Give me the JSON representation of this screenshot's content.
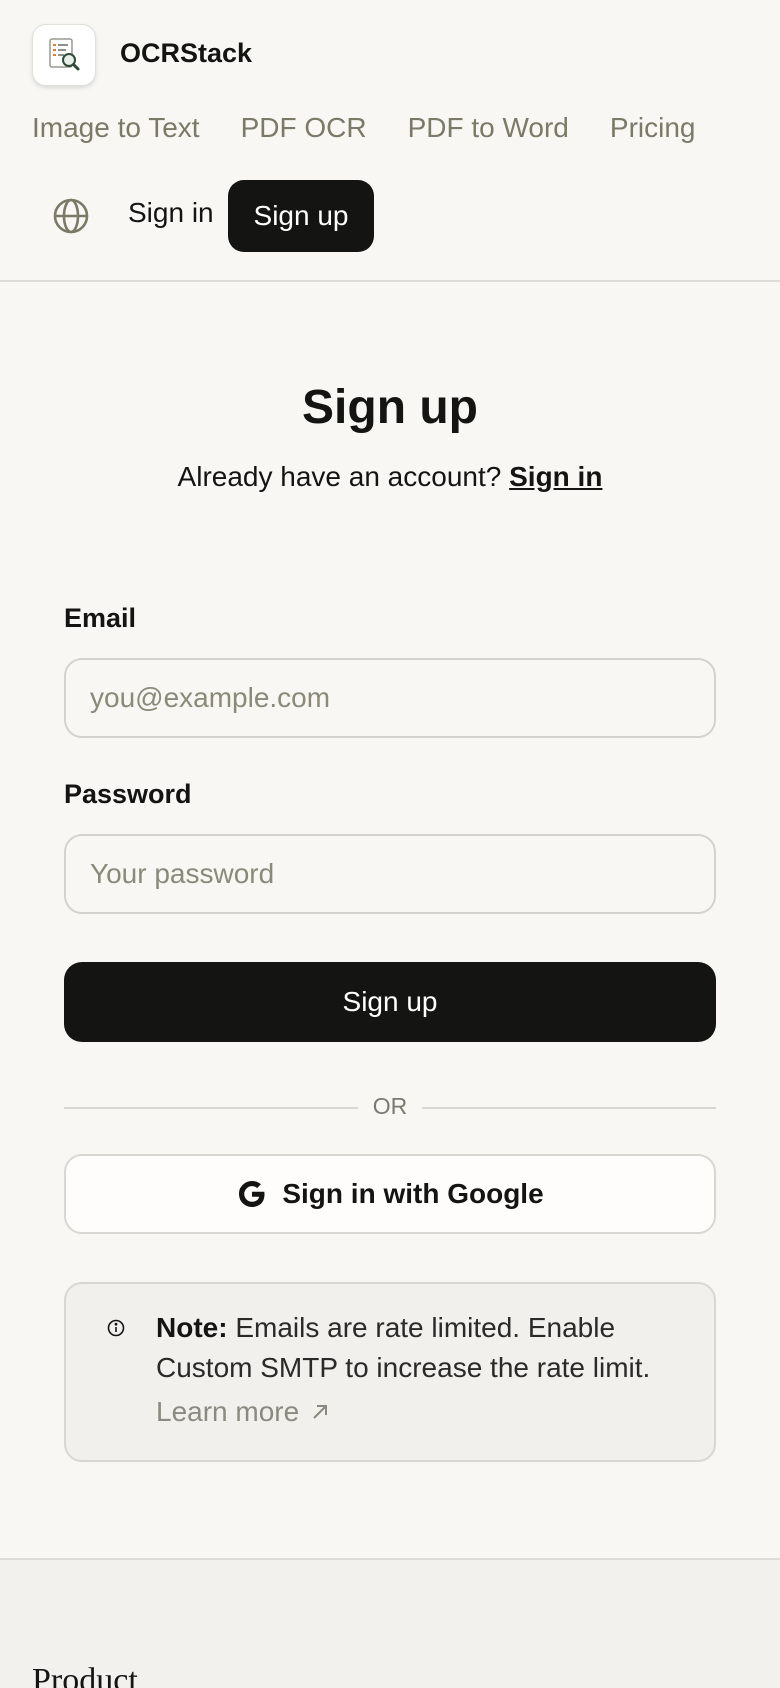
{
  "header": {
    "brand": "OCRStack",
    "logo_icon": "document-search-icon",
    "nav": [
      {
        "label": "Image to Text"
      },
      {
        "label": "PDF OCR"
      },
      {
        "label": "PDF to Word"
      },
      {
        "label": "Pricing"
      }
    ],
    "language_icon": "globe-icon",
    "sign_in": "Sign in",
    "sign_up": "Sign up"
  },
  "form": {
    "title": "Sign up",
    "subtitle_prefix": "Already have an account?",
    "subtitle_link": "Sign in",
    "email_label": "Email",
    "email_placeholder": "you@example.com",
    "password_label": "Password",
    "password_placeholder": "Your password",
    "submit": "Sign up",
    "divider": "OR",
    "google_button": "Sign in with Google"
  },
  "note": {
    "bold": "Note:",
    "text": " Emails are rate limited. Enable Custom SMTP to increase the rate limit.",
    "link": "Learn more"
  },
  "footer": {
    "section_title": "Product"
  },
  "colors": {
    "primary": "#141413",
    "muted": "#7a7a66",
    "background": "#f8f7f4"
  }
}
